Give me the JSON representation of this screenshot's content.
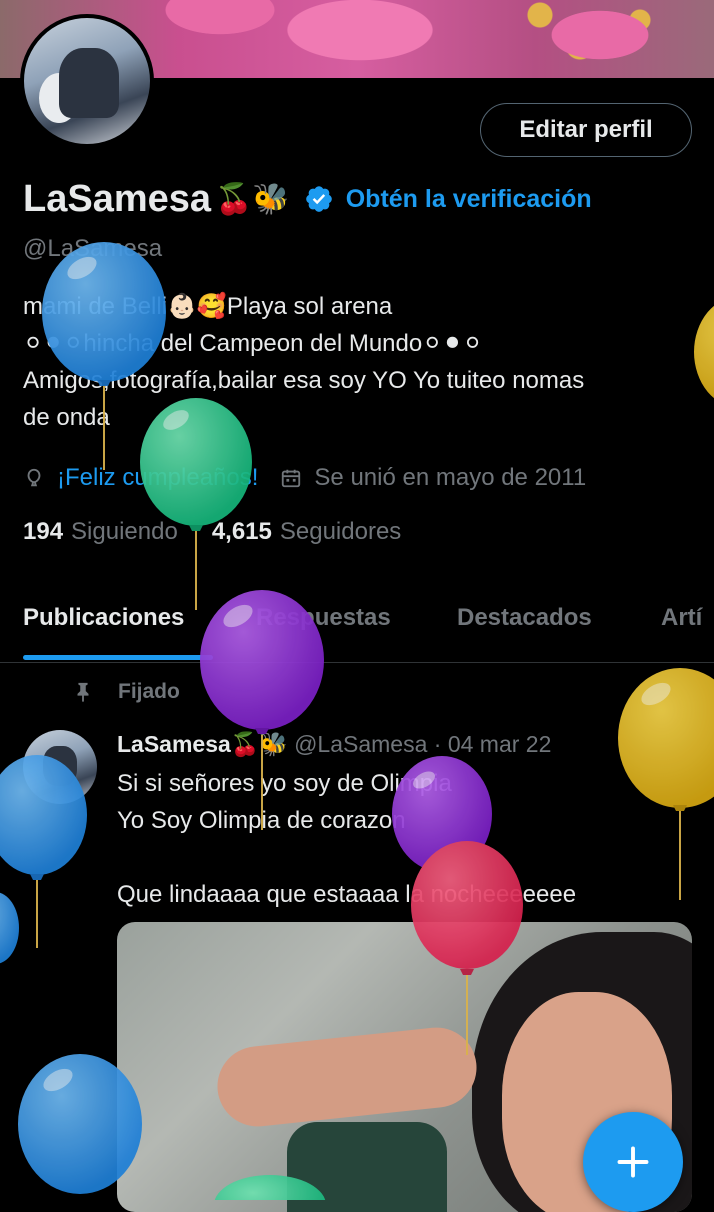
{
  "profile": {
    "name": "LaSamesa",
    "name_emoji": "🍒🐝",
    "verify_link": "Obtén la verificación",
    "handle": "@LaSamesa",
    "edit_button": "Editar perfil",
    "bio": [
      "mami de Belli👶🏻🥰Playa sol arena",
      "⚪⚫⚪hincha del Campeon del Mundo⚪⚫⚪",
      "Amigos,fotografía,bailar esa soy YO Yo tuiteo nomas",
      "de onda"
    ],
    "birthday": "¡Feliz cumpleaños!",
    "joined": "Se unió en mayo de 2011",
    "following_count": "194",
    "following_label": "Siguiendo",
    "followers_count": "4,615",
    "followers_label": "Seguidores"
  },
  "tabs": [
    "Publicaciones",
    "Respuestas",
    "Destacados",
    "Artí"
  ],
  "post": {
    "pinned_label": "Fijado",
    "author": "LaSamesa🍒🐝",
    "handle_date": "@LaSamesa · 04 mar 22",
    "lines": [
      "Si si señores yo soy de Olimpia",
      "Yo Soy Olimpia de corazon",
      "",
      "Que lindaaaa que estaaaa la nocheeeeeee"
    ]
  },
  "colors": {
    "accent": "#1d9bf0",
    "muted": "#71767b",
    "text": "#e7e9ea",
    "background": "#000000"
  },
  "balloons": [
    "blue",
    "green",
    "purple",
    "yellow",
    "blue",
    "purple",
    "red",
    "blue",
    "blue",
    "green",
    "yellow"
  ]
}
